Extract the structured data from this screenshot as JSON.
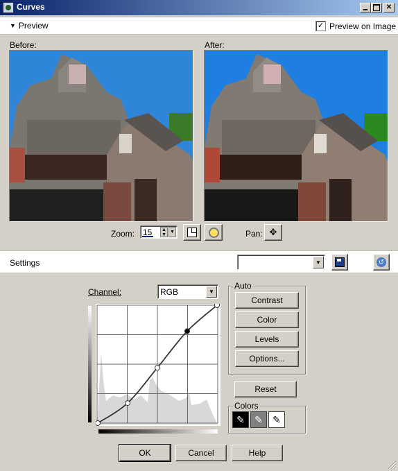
{
  "window": {
    "title": "Curves"
  },
  "preview": {
    "label": "Preview",
    "preview_on_image_label": "Preview on Image",
    "preview_on_image_checked": true
  },
  "before": {
    "label": "Before:"
  },
  "after": {
    "label": "After:"
  },
  "zoom": {
    "label": "Zoom:",
    "value": "15"
  },
  "pan": {
    "label": "Pan:"
  },
  "settings": {
    "label": "Settings",
    "preset_value": ""
  },
  "channel": {
    "label": "Channel:",
    "value": "RGB"
  },
  "auto": {
    "label": "Auto",
    "contrast": "Contrast",
    "color": "Color",
    "levels": "Levels",
    "options": "Options..."
  },
  "reset_label": "Reset",
  "colors": {
    "label": "Colors"
  },
  "footer": {
    "ok": "OK",
    "cancel": "Cancel",
    "help": "Help"
  },
  "curve": {
    "points": [
      [
        0,
        0
      ],
      [
        0.25,
        0.17
      ],
      [
        0.5,
        0.47
      ],
      [
        0.75,
        0.78
      ],
      [
        1,
        1
      ]
    ],
    "selected_index": 3
  }
}
